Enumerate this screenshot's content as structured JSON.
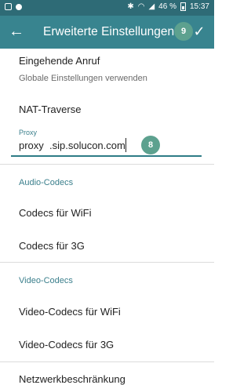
{
  "status_bar": {
    "battery_percent": "46 %",
    "time": "15:37"
  },
  "app_bar": {
    "title": "Erweiterte Einstellungen",
    "back_icon": "arrow-left-icon",
    "confirm_icon": "checkmark-icon"
  },
  "annotations": {
    "badge_9": "9",
    "badge_8": "8"
  },
  "settings": {
    "incoming_call": {
      "title": "Eingehende Anruf",
      "summary": "Globale Einstellungen verwenden"
    },
    "nat_traversal": "NAT-Traverse",
    "proxy": {
      "label": "Proxy",
      "value": "proxy  .sip.solucon.com"
    },
    "audio_codecs": {
      "header": "Audio-Codecs",
      "items": [
        "Codecs für WiFi",
        "Codecs für 3G"
      ]
    },
    "video_codecs": {
      "header": "Video-Codecs",
      "items": [
        "Video-Codecs für WiFi",
        "Video-Codecs für 3G"
      ]
    },
    "network_limit": "Netzwerkbeschränkung"
  },
  "colors": {
    "status_bar": "#2e6b76",
    "app_bar": "#38848f",
    "accent": "#3b7f8c",
    "badge": "#5da18f"
  }
}
